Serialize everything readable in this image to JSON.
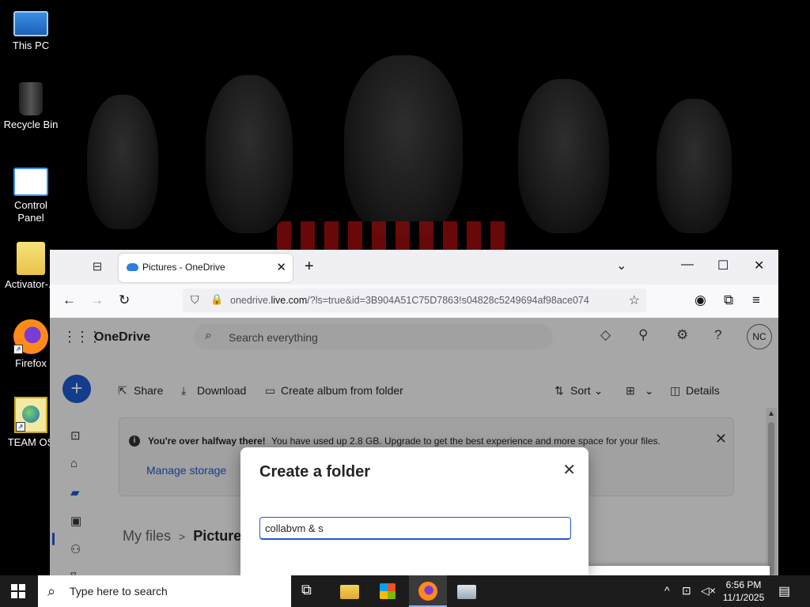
{
  "desktop": {
    "icons": [
      {
        "label": "This PC"
      },
      {
        "label": "Recycle Bin"
      },
      {
        "label": "Control\nPanel"
      },
      {
        "label": "Activator-..."
      },
      {
        "label": "Firefox"
      },
      {
        "label": "TEAM OS"
      }
    ]
  },
  "browser": {
    "tab_title": "Pictures - OneDrive",
    "url_prefix": "onedrive.",
    "url_domain": "live.com",
    "url_rest": "/?ls=true&id=3B904A51C75D7863!s04828c5249694af98ace074",
    "new_tab": "+",
    "close_tab": "✕"
  },
  "onedrive": {
    "brand": "OneDrive",
    "search_placeholder": "Search everything",
    "avatar": "NC",
    "commands": {
      "share": "Share",
      "download": "Download",
      "create_album": "Create album from folder",
      "sort": "Sort",
      "details": "Details"
    },
    "banner": {
      "heading": "You're over halfway there!",
      "message": "You have used up 2.8 GB. Upgrade to get the best experience and more space for your files.",
      "link": "Manage storage"
    },
    "breadcrumb": {
      "root": "My files",
      "current": "Pictures"
    }
  },
  "dialog": {
    "title": "Create a folder",
    "input_value": "collabvm & s"
  },
  "taskbar": {
    "search_text": "Type here to search",
    "time": "6:56 PM",
    "date": "11/1/2025"
  }
}
